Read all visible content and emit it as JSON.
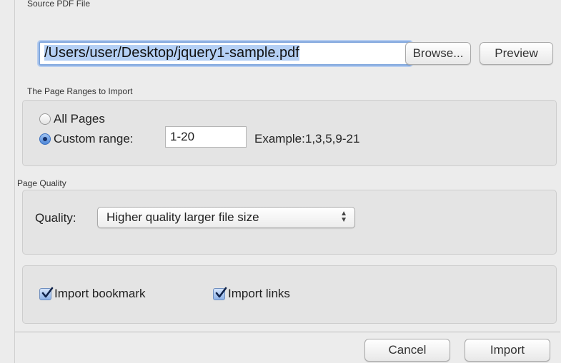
{
  "source": {
    "section_title": "Source PDF File",
    "path_value": "/Users/user/Desktop/jquery1-sample.pdf",
    "browse_label": "Browse...",
    "preview_label": "Preview"
  },
  "ranges": {
    "section_title": "The Page Ranges to Import",
    "all_pages_label": "All Pages",
    "custom_range_label": "Custom range:",
    "custom_range_value": "1-20",
    "example_text": "Example:1,3,5,9-21",
    "selected": "custom"
  },
  "quality": {
    "section_title": "Page Quality",
    "label": "Quality:",
    "selected_value": "Higher quality larger file size"
  },
  "options": {
    "import_bookmark_label": "Import bookmark",
    "import_bookmark_checked": true,
    "import_links_label": "Import links",
    "import_links_checked": true
  },
  "footer": {
    "cancel_label": "Cancel",
    "import_label": "Import"
  },
  "colors": {
    "accent": "#4f88d8",
    "focus_ring": "#7fa6dd",
    "selection": "#b5d0f5",
    "dialog_bg": "#ececec",
    "group_bg": "#e4e4e4"
  }
}
